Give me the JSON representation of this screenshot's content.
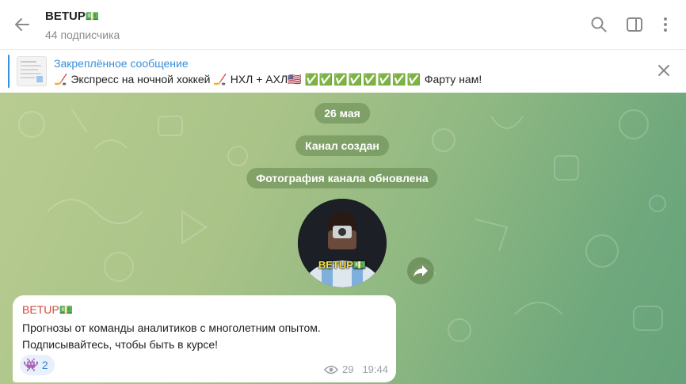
{
  "header": {
    "title": "BETUP",
    "title_emoji": "💵",
    "subtitle": "44 подписчика",
    "icons": [
      "back-arrow-icon",
      "search-icon",
      "sidebar-toggle-icon",
      "more-vertical-icon"
    ]
  },
  "pinned": {
    "title": "Закреплённое сообщение",
    "text_part1": "🏒 Экспресс на ночной хоккей 🏒 НХЛ + АХЛ🇺🇸",
    "checks": "✅✅✅✅✅✅✅✅",
    "text_part2": "Фарту нам!",
    "close_icon": "close-icon"
  },
  "chat": {
    "service_date": "26 мая",
    "service_created": "Канал создан",
    "service_photo": "Фотография канала обновлена",
    "photo_caption": "BETUP💵",
    "message": {
      "author": "BETUP💵",
      "line1": "Прогнозы от команды аналитиков с многолетним опытом.",
      "line2": "Подписывайтесь, чтобы быть в курсе!",
      "reaction_emoji": "👾",
      "reaction_count": "2",
      "views": "29",
      "time": "19:44"
    }
  },
  "colors": {
    "accent": "#3a8fd9",
    "author": "#d04a3a",
    "check": "#22a722",
    "chat_bg_start": "#b8cc90",
    "chat_bg_end": "#66a27a"
  }
}
